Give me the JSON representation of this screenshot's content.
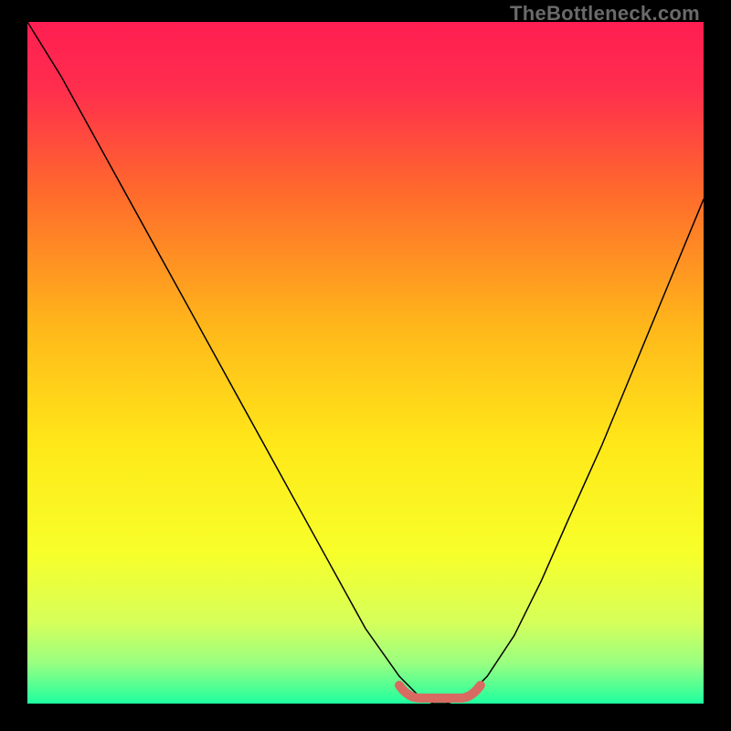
{
  "watermark": "TheBottleneck.com",
  "colors": {
    "gradient_stops": [
      {
        "offset": 0.0,
        "color": "#ff1e52"
      },
      {
        "offset": 0.1,
        "color": "#ff2e4d"
      },
      {
        "offset": 0.25,
        "color": "#ff6a2c"
      },
      {
        "offset": 0.45,
        "color": "#ffb81a"
      },
      {
        "offset": 0.62,
        "color": "#ffe819"
      },
      {
        "offset": 0.78,
        "color": "#f7ff2a"
      },
      {
        "offset": 0.88,
        "color": "#d6ff5a"
      },
      {
        "offset": 0.94,
        "color": "#9aff80"
      },
      {
        "offset": 1.0,
        "color": "#1effa0"
      }
    ],
    "curve_stroke": "#000000",
    "band_stroke": "#d86a61",
    "band_stroke_width": 10
  },
  "chart_data": {
    "type": "line",
    "title": "",
    "xlabel": "",
    "ylabel": "",
    "xlim": [
      0,
      100
    ],
    "ylim": [
      0,
      100
    ],
    "grid": false,
    "series": [
      {
        "name": "bottleneck-curve",
        "x": [
          0,
          5,
          10,
          15,
          20,
          25,
          30,
          35,
          40,
          45,
          50,
          55,
          58,
          60,
          62,
          65,
          68,
          72,
          76,
          80,
          85,
          90,
          95,
          100
        ],
        "values": [
          100,
          92,
          83,
          74,
          65,
          56,
          47,
          38,
          29,
          20,
          11,
          4,
          1,
          0,
          0,
          1,
          4,
          10,
          18,
          27,
          38,
          50,
          62,
          74
        ]
      }
    ],
    "annotations": [
      {
        "name": "flat-bottom-band",
        "x_start": 55,
        "x_end": 67,
        "y": 0
      }
    ]
  }
}
